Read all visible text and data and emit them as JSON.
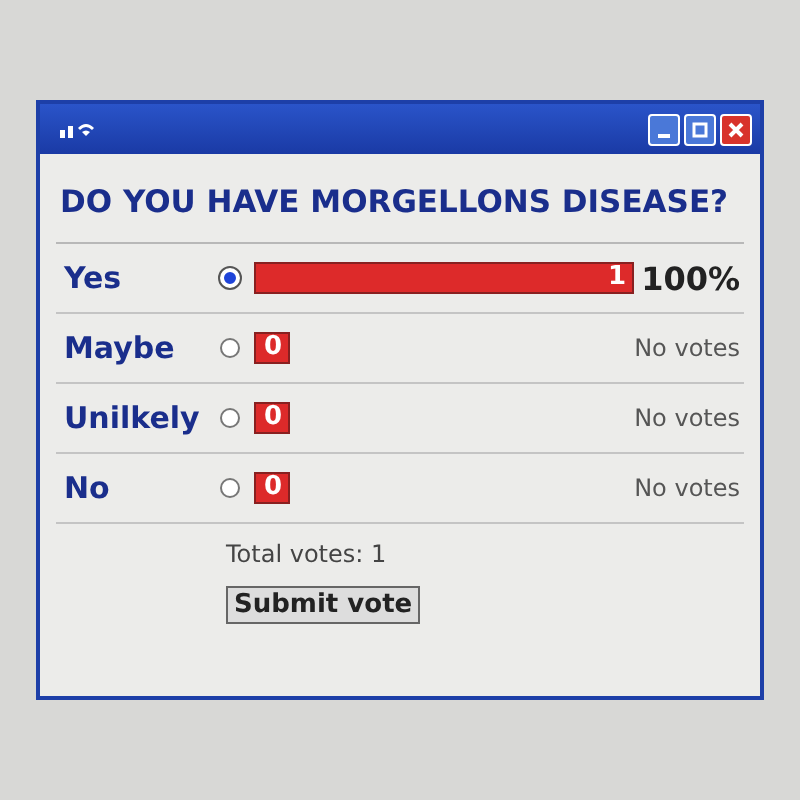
{
  "poll": {
    "question": "DO YOU HAVE MORGELLONS DISEASE?",
    "options": [
      {
        "label": "Yes",
        "selected": true,
        "count": "1",
        "kind": "bar",
        "reading": "100%"
      },
      {
        "label": "Maybe",
        "selected": false,
        "count": "0",
        "kind": "count",
        "reading": "No votes"
      },
      {
        "label": "Unilkely",
        "selected": false,
        "count": "0",
        "kind": "count",
        "reading": "No votes"
      },
      {
        "label": "No",
        "selected": false,
        "count": "0",
        "kind": "count",
        "reading": "No votes"
      }
    ],
    "total": "Total votes: 1",
    "submit": "Submit vote"
  }
}
